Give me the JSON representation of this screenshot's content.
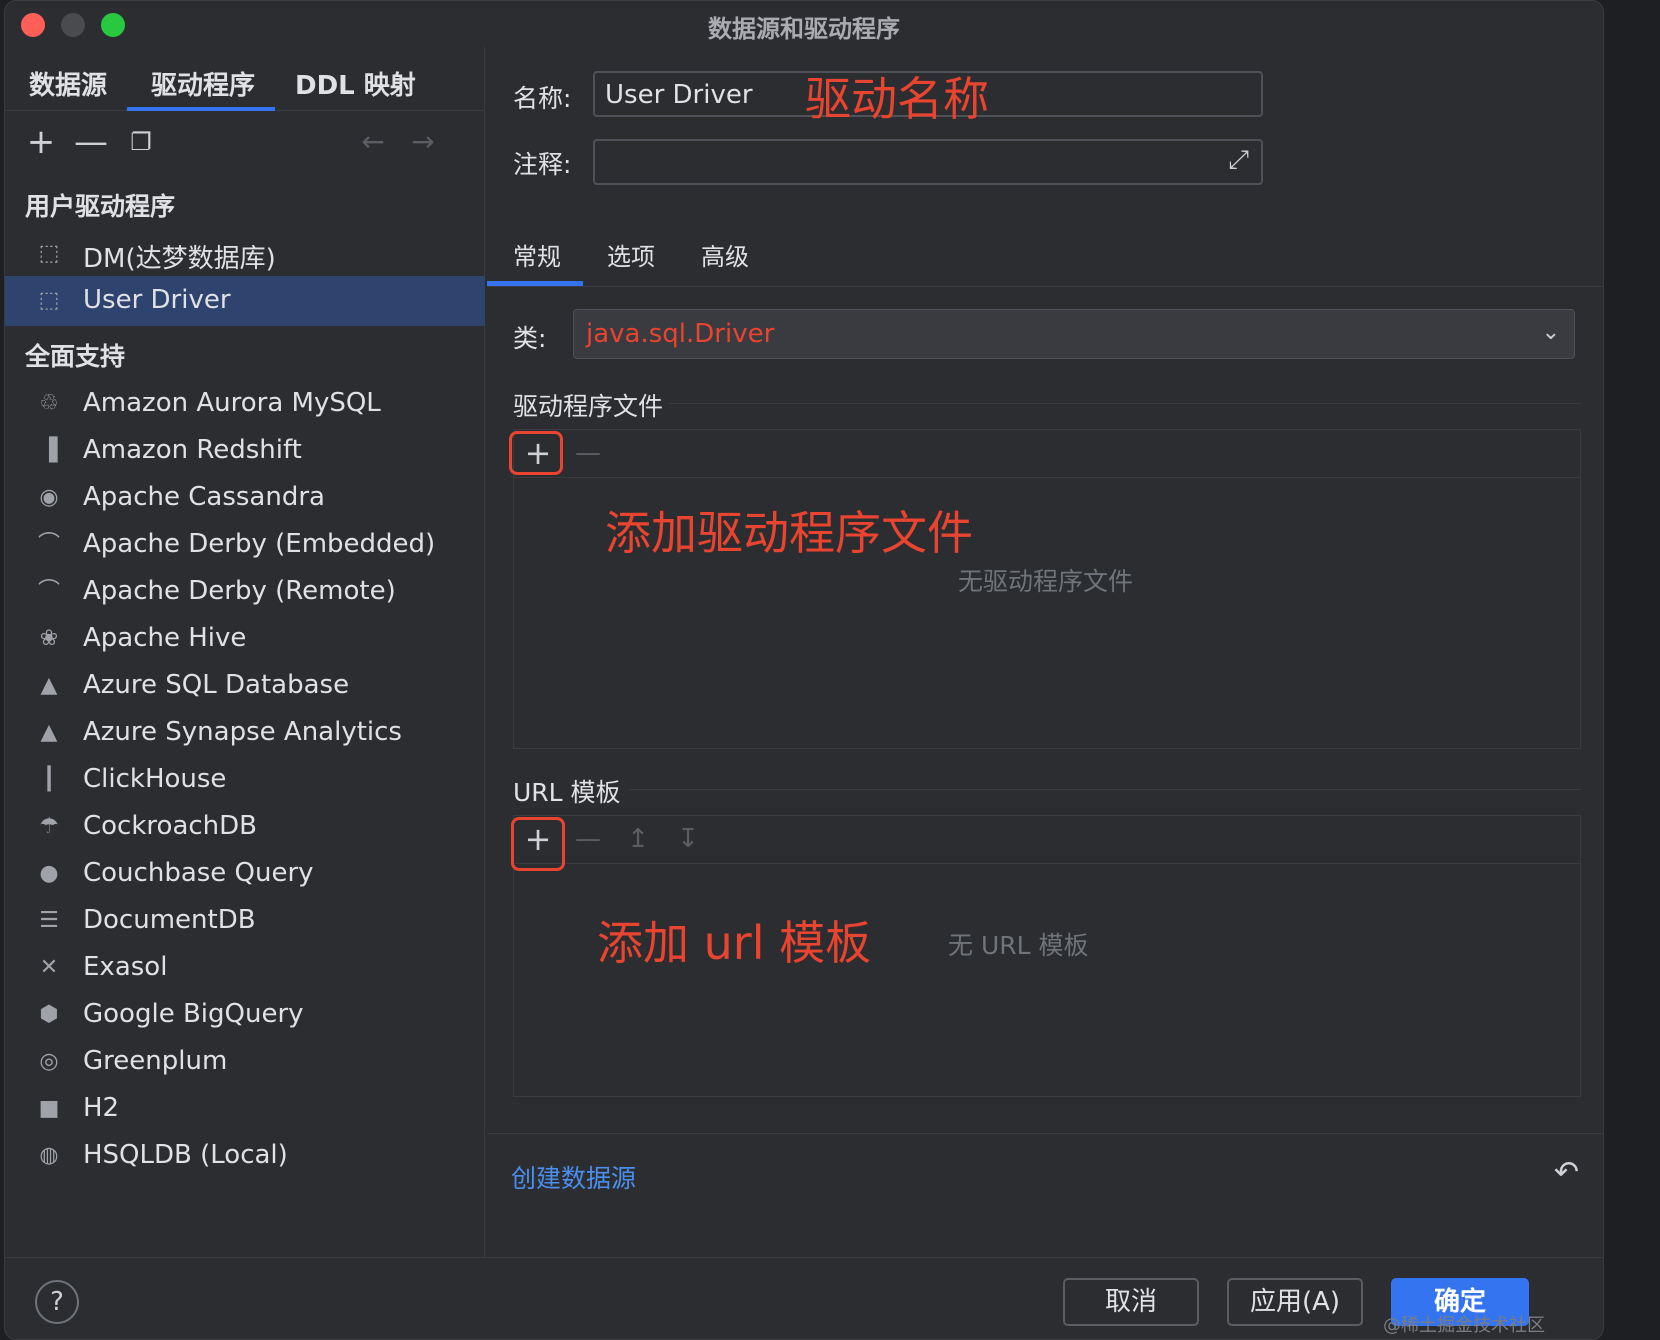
{
  "window": {
    "title": "数据源和驱动程序"
  },
  "left_tabs": [
    "数据源",
    "驱动程序",
    "DDL 映射"
  ],
  "sections": {
    "user_drivers": "用户驱动程序",
    "full_support": "全面支持"
  },
  "user_drivers": [
    {
      "label": "DM(达梦数据库)",
      "icon": "driver-icon"
    },
    {
      "label": "User Driver",
      "icon": "driver-icon",
      "selected": true
    }
  ],
  "drivers": [
    {
      "label": "Amazon Aurora MySQL",
      "icon": "mysql-dolphin-icon"
    },
    {
      "label": "Amazon Redshift",
      "icon": "redshift-icon"
    },
    {
      "label": "Apache Cassandra",
      "icon": "cassandra-eye-icon"
    },
    {
      "label": "Apache Derby (Embedded)",
      "icon": "derby-hat-icon"
    },
    {
      "label": "Apache Derby (Remote)",
      "icon": "derby-hat-icon"
    },
    {
      "label": "Apache Hive",
      "icon": "hive-bee-icon"
    },
    {
      "label": "Azure SQL Database",
      "icon": "azure-icon"
    },
    {
      "label": "Azure Synapse Analytics",
      "icon": "azure-icon"
    },
    {
      "label": "ClickHouse",
      "icon": "clickhouse-bars-icon"
    },
    {
      "label": "CockroachDB",
      "icon": "cockroach-icon"
    },
    {
      "label": "Couchbase Query",
      "icon": "couchbase-icon"
    },
    {
      "label": "DocumentDB",
      "icon": "documentdb-icon"
    },
    {
      "label": "Exasol",
      "icon": "exasol-x-icon"
    },
    {
      "label": "Google BigQuery",
      "icon": "bigquery-icon"
    },
    {
      "label": "Greenplum",
      "icon": "greenplum-icon"
    },
    {
      "label": "H2",
      "icon": "h2-icon"
    },
    {
      "label": "HSQLDB (Local)",
      "icon": "hsqldb-icon"
    }
  ],
  "form": {
    "name_label": "名称:",
    "name_value": "User Driver",
    "comment_label": "注释:",
    "comment_value": ""
  },
  "annotations": {
    "name": "驱动名称",
    "add_file": "添加驱动程序文件",
    "add_url": "添加 url 模板"
  },
  "tabs": [
    "常规",
    "选项",
    "高级"
  ],
  "class_label": "类:",
  "class_value": "java.sql.Driver",
  "driver_files": {
    "title": "驱动程序文件",
    "empty": "无驱动程序文件"
  },
  "url_templates": {
    "title": "URL 模板",
    "empty": "无 URL 模板"
  },
  "create_datasource_link": "创建数据源",
  "buttons": {
    "cancel": "取消",
    "apply": "应用(A)",
    "ok": "确定",
    "help": "?"
  },
  "watermark": "@稀土掘金技术社区",
  "colors": {
    "accent": "#3574f0",
    "annotation": "#e8442f",
    "selection": "#2e436e"
  }
}
